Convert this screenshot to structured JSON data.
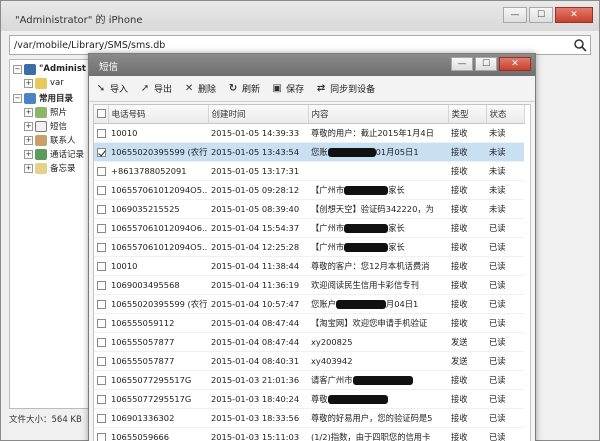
{
  "main_window": {
    "title": "\"Administrator\" 的 iPhone",
    "path": "/var/mobile/Library/SMS/sms.db",
    "status": "文件大小：564 KB"
  },
  "tree": {
    "root": "\"Administ",
    "var": "var",
    "common": "常用目录",
    "items": [
      "照片",
      "短信",
      "联系人",
      "通话记录",
      "备忘录"
    ]
  },
  "sms_dialog": {
    "title": "短信",
    "toolbar": [
      "导入",
      "导出",
      "删除",
      "刷新",
      "保存",
      "同步到设备"
    ],
    "columns": [
      "电话号码",
      "创建时间",
      "内容",
      "类型",
      "状态"
    ],
    "rows": [
      {
        "phone": "10010",
        "time": "2015-01-05 14:39:33",
        "content": "尊敬的用户：截止2015年1月4日",
        "redact": 0,
        "tail": "",
        "type": "接收",
        "status": "未读",
        "checked": false,
        "selected": false
      },
      {
        "phone": "10655020395599 (农行)",
        "time": "2015-01-05 13:43:54",
        "content": "您账",
        "redact": 48,
        "tail": "01月05日1",
        "type": "接收",
        "status": "未读",
        "checked": true,
        "selected": true
      },
      {
        "phone": "+8613788052091",
        "time": "2015-01-05 13:17:31",
        "content": "",
        "redact": 0,
        "tail": "",
        "type": "接收",
        "status": "未读",
        "checked": false,
        "selected": false
      },
      {
        "phone": "106557061012094O5...",
        "time": "2015-01-05 09:28:12",
        "content": "【广州市",
        "redact": 44,
        "tail": "家长",
        "type": "接收",
        "status": "未读",
        "checked": false,
        "selected": false
      },
      {
        "phone": "1069035215525",
        "time": "2015-01-05 08:39:40",
        "content": "【创想天空】验证码342220，为",
        "redact": 0,
        "tail": "",
        "type": "接收",
        "status": "未读",
        "checked": false,
        "selected": false
      },
      {
        "phone": "106557061012094O6...",
        "time": "2015-01-04 15:54:37",
        "content": "【广州市",
        "redact": 44,
        "tail": "家长",
        "type": "接收",
        "status": "已读",
        "checked": false,
        "selected": false
      },
      {
        "phone": "106557061012094O5...",
        "time": "2015-01-04 12:25:28",
        "content": "【广州市",
        "redact": 44,
        "tail": "家长",
        "type": "接收",
        "status": "已读",
        "checked": false,
        "selected": false
      },
      {
        "phone": "10010",
        "time": "2015-01-04 11:38:44",
        "content": "尊敬的客户：您12月本机话费消",
        "redact": 0,
        "tail": "",
        "type": "接收",
        "status": "已读",
        "checked": false,
        "selected": false
      },
      {
        "phone": "1069003495568",
        "time": "2015-01-04 11:36:19",
        "content": "欢迎阅读民生信用卡彩信专刊",
        "redact": 0,
        "tail": "",
        "type": "接收",
        "status": "已读",
        "checked": false,
        "selected": false
      },
      {
        "phone": "10655020395599 (农行)",
        "time": "2015-01-04 10:57:47",
        "content": "您账户",
        "redact": 50,
        "tail": "月04日1",
        "type": "接收",
        "status": "已读",
        "checked": false,
        "selected": false
      },
      {
        "phone": "106555059112",
        "time": "2015-01-04 08:47:44",
        "content": "【淘宝网】欢迎您申请手机验证",
        "redact": 0,
        "tail": "",
        "type": "接收",
        "status": "已读",
        "checked": false,
        "selected": false
      },
      {
        "phone": "106555057877",
        "time": "2015-01-04 08:47:44",
        "content": "xy200825",
        "redact": 0,
        "tail": "",
        "type": "发送",
        "status": "已读",
        "checked": false,
        "selected": false
      },
      {
        "phone": "106555057877",
        "time": "2015-01-04 08:40:31",
        "content": "xy403942",
        "redact": 0,
        "tail": "",
        "type": "发送",
        "status": "已读",
        "checked": false,
        "selected": false
      },
      {
        "phone": "10655077295517G",
        "time": "2015-01-03 21:01:36",
        "content": "请客广州市",
        "redact": 60,
        "tail": "",
        "type": "接收",
        "status": "已读",
        "checked": false,
        "selected": false
      },
      {
        "phone": "10655077295517G",
        "time": "2015-01-03 18:40:24",
        "content": "尊敬",
        "redact": 60,
        "tail": "",
        "type": "接收",
        "status": "已读",
        "checked": false,
        "selected": false
      },
      {
        "phone": "106901336302",
        "time": "2015-01-03 18:33:56",
        "content": "尊敬的好易用户，您的验证码是5",
        "redact": 0,
        "tail": "",
        "type": "接收",
        "status": "已读",
        "checked": false,
        "selected": false
      },
      {
        "phone": "10655059666",
        "time": "2015-01-03 15:11:03",
        "content": "(1/2)指数，由于四职您的信用卡",
        "redact": 0,
        "tail": "",
        "type": "接收",
        "status": "已读",
        "checked": false,
        "selected": false
      }
    ]
  }
}
